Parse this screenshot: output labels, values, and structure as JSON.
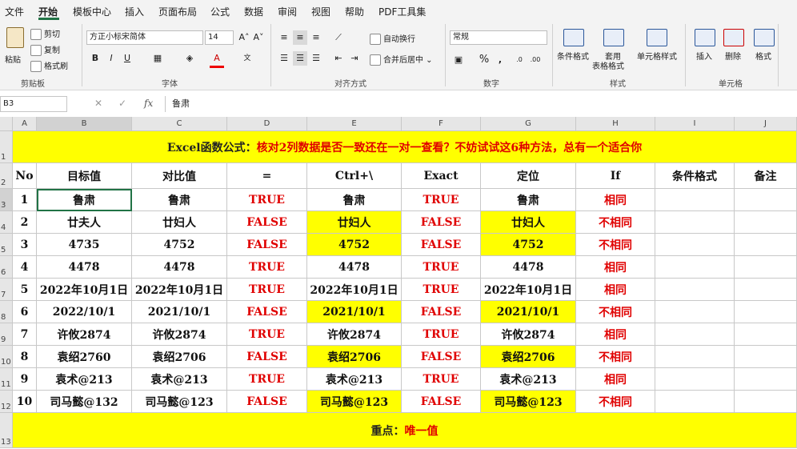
{
  "menu": [
    "文件",
    "开始",
    "模板中心",
    "插入",
    "页面布局",
    "公式",
    "数据",
    "审阅",
    "视图",
    "帮助",
    "PDF工具集"
  ],
  "ribbon": {
    "paste": "粘贴",
    "cut": "剪切",
    "copy": "复制",
    "format_painter": "格式刷",
    "clipboard_group": "剪贴板",
    "font_name": "方正小标宋简体",
    "font_size": "14",
    "font_group": "字体",
    "wrap_text": "自动换行",
    "merge_center": "合并后居中",
    "alignment_group": "对齐方式",
    "number_format": "常规",
    "number_group": "数字",
    "conditional_format": "条件格式",
    "table_format_line1": "套用",
    "table_format_line2": "表格格式",
    "cell_style": "单元格样式",
    "styles_group": "样式",
    "insert": "插入",
    "delete": "删除",
    "format": "格式",
    "cells_group": "单元格"
  },
  "formula_bar": {
    "name_box": "B3",
    "content": "鲁肃"
  },
  "columns": [
    "A",
    "B",
    "C",
    "D",
    "E",
    "F",
    "G",
    "H",
    "I",
    "J"
  ],
  "title_row": {
    "black": "Excel函数公式：",
    "red": "核对2列数据是否一致还在一对一查看？不妨试试这6种方法，总有一个适合你"
  },
  "headers": [
    "No",
    "目标值",
    "对比值",
    "=",
    "Ctrl+\\",
    "Exact",
    "定位",
    "If",
    "条件格式",
    "备注"
  ],
  "rows": [
    {
      "no": "1",
      "target": "鲁肃",
      "compare": "鲁肃",
      "eq": "TRUE",
      "ctrl": "鲁肃",
      "exact": "TRUE",
      "locate": "鲁肃",
      "if": "相同",
      "diff": false
    },
    {
      "no": "2",
      "target": "廿夫人",
      "compare": "廿妇人",
      "eq": "FALSE",
      "ctrl": "廿妇人",
      "exact": "FALSE",
      "locate": "廿妇人",
      "if": "不相同",
      "diff": true
    },
    {
      "no": "3",
      "target": "4735",
      "compare": "4752",
      "eq": "FALSE",
      "ctrl": "4752",
      "exact": "FALSE",
      "locate": "4752",
      "if": "不相同",
      "diff": true
    },
    {
      "no": "4",
      "target": "4478",
      "compare": "4478",
      "eq": "TRUE",
      "ctrl": "4478",
      "exact": "TRUE",
      "locate": "4478",
      "if": "相同",
      "diff": false
    },
    {
      "no": "5",
      "target": "2022年10月1日",
      "compare": "2022年10月1日",
      "eq": "TRUE",
      "ctrl": "2022年10月1日",
      "exact": "TRUE",
      "locate": "2022年10月1日",
      "if": "相同",
      "diff": false
    },
    {
      "no": "6",
      "target": "2022/10/1",
      "compare": "2021/10/1",
      "eq": "FALSE",
      "ctrl": "2021/10/1",
      "exact": "FALSE",
      "locate": "2021/10/1",
      "if": "不相同",
      "diff": true
    },
    {
      "no": "7",
      "target": "许攸2874",
      "compare": "许攸2874",
      "eq": "TRUE",
      "ctrl": "许攸2874",
      "exact": "TRUE",
      "locate": "许攸2874",
      "if": "相同",
      "diff": false
    },
    {
      "no": "8",
      "target": "袁绍2760",
      "compare": "袁绍2706",
      "eq": "FALSE",
      "ctrl": "袁绍2706",
      "exact": "FALSE",
      "locate": "袁绍2706",
      "if": "不相同",
      "diff": true
    },
    {
      "no": "9",
      "target": "袁术@213",
      "compare": "袁术@213",
      "eq": "TRUE",
      "ctrl": "袁术@213",
      "exact": "TRUE",
      "locate": "袁术@213",
      "if": "相同",
      "diff": false
    },
    {
      "no": "10",
      "target": "司马懿@132",
      "compare": "司马懿@123",
      "eq": "FALSE",
      "ctrl": "司马懿@123",
      "exact": "FALSE",
      "locate": "司马懿@123",
      "if": "不相同",
      "diff": true
    }
  ],
  "footer_row": {
    "black": "重点：",
    "red": "唯一值"
  },
  "colors": {
    "highlight": "#ffff00",
    "red_text": "#e00000",
    "accent": "#217346"
  }
}
